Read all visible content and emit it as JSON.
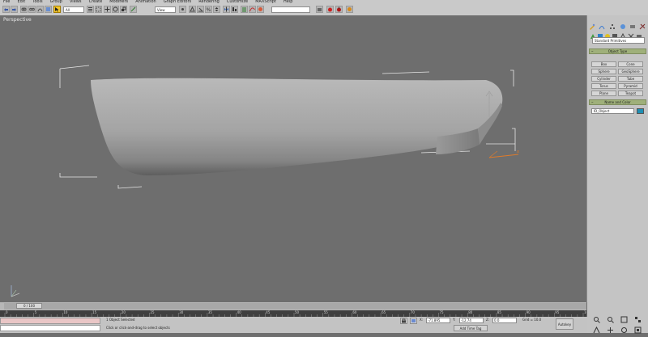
{
  "menu": [
    "File",
    "Edit",
    "Tools",
    "Group",
    "Views",
    "Create",
    "Modifiers",
    "Animation",
    "Graph Editors",
    "Rendering",
    "Customize",
    "MAXScript",
    "Help"
  ],
  "toolbar": {
    "selection_filter": "All",
    "reference_coord": "View",
    "named_selection": ""
  },
  "viewport": {
    "label": "Perspective"
  },
  "command_panel": {
    "category": "Standard Primitives",
    "object_type": {
      "title": "Object Type",
      "buttons": [
        "Box",
        "Cone",
        "Sphere",
        "GeoSphere",
        "Cylinder",
        "Tube",
        "Torus",
        "Pyramid",
        "Teapot",
        "Plane"
      ]
    },
    "name_and_color": {
      "title": "Name and Color",
      "name_value": "ID_Object",
      "color": "#1f8fb3"
    }
  },
  "timeline": {
    "slider_label": "0 / 100",
    "ticks": [
      "0",
      "5",
      "10",
      "15",
      "20",
      "25",
      "30",
      "35",
      "40",
      "45",
      "50",
      "55",
      "60",
      "65",
      "70",
      "75",
      "80",
      "85",
      "90",
      "95",
      "100"
    ]
  },
  "status": {
    "selected": "1 Object Selected",
    "prompt": "Click or click-and-drag to select objects",
    "x": "-71.895",
    "y": "-12.74",
    "z": "0.0",
    "grid": "Grid = 10.0",
    "add_time_tag": "Add Time Tag",
    "autokey": "Autokey",
    "set_key": "Set Key"
  },
  "colors": {
    "viewport_bg": "#6e6e6e",
    "panel_bg": "#c4c4c4",
    "rollout": "#9fb07a",
    "active_tool": "#f2c62b"
  }
}
